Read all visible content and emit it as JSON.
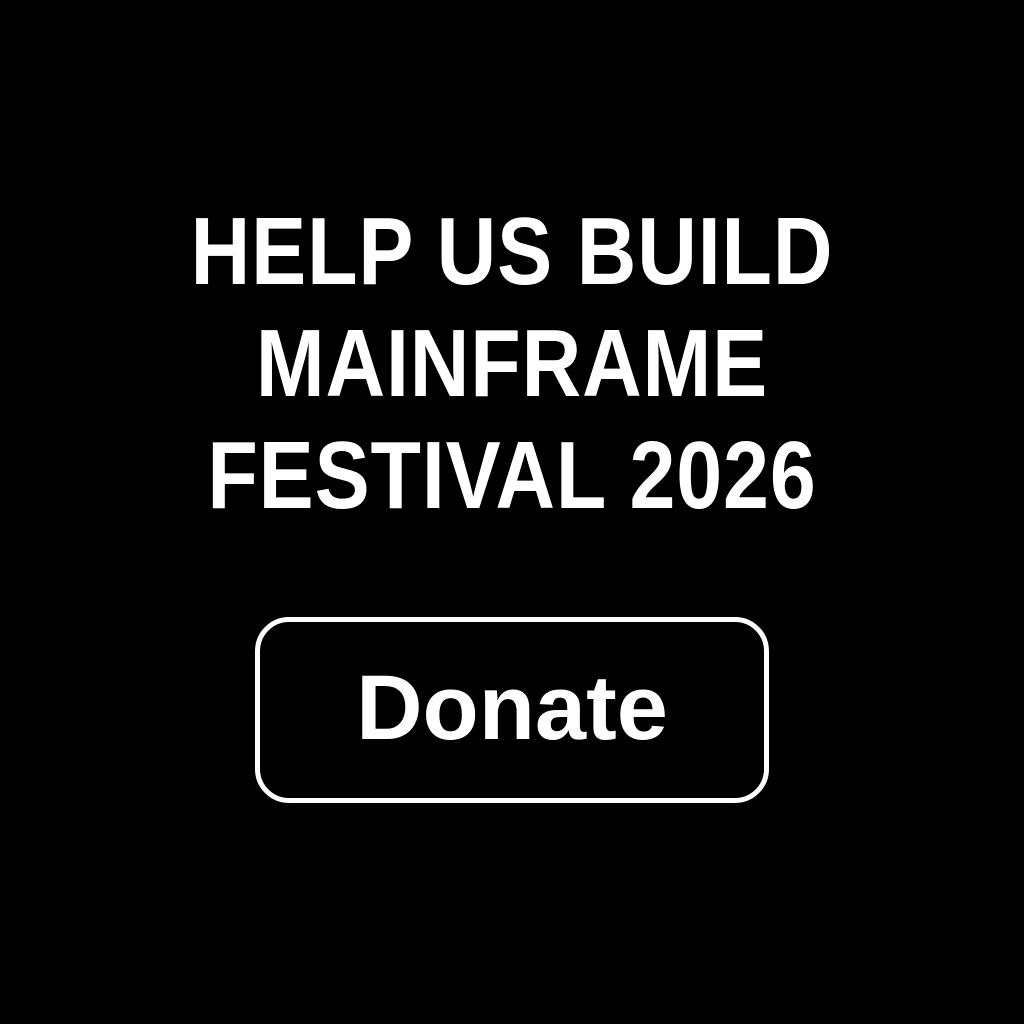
{
  "headline": {
    "lines": [
      "HELP US BUILD",
      "MAINFRAME",
      "FESTIVAL 2026"
    ]
  },
  "donate_button": {
    "label": "Donate"
  },
  "colors": {
    "background": "#000000",
    "foreground": "#ffffff"
  }
}
